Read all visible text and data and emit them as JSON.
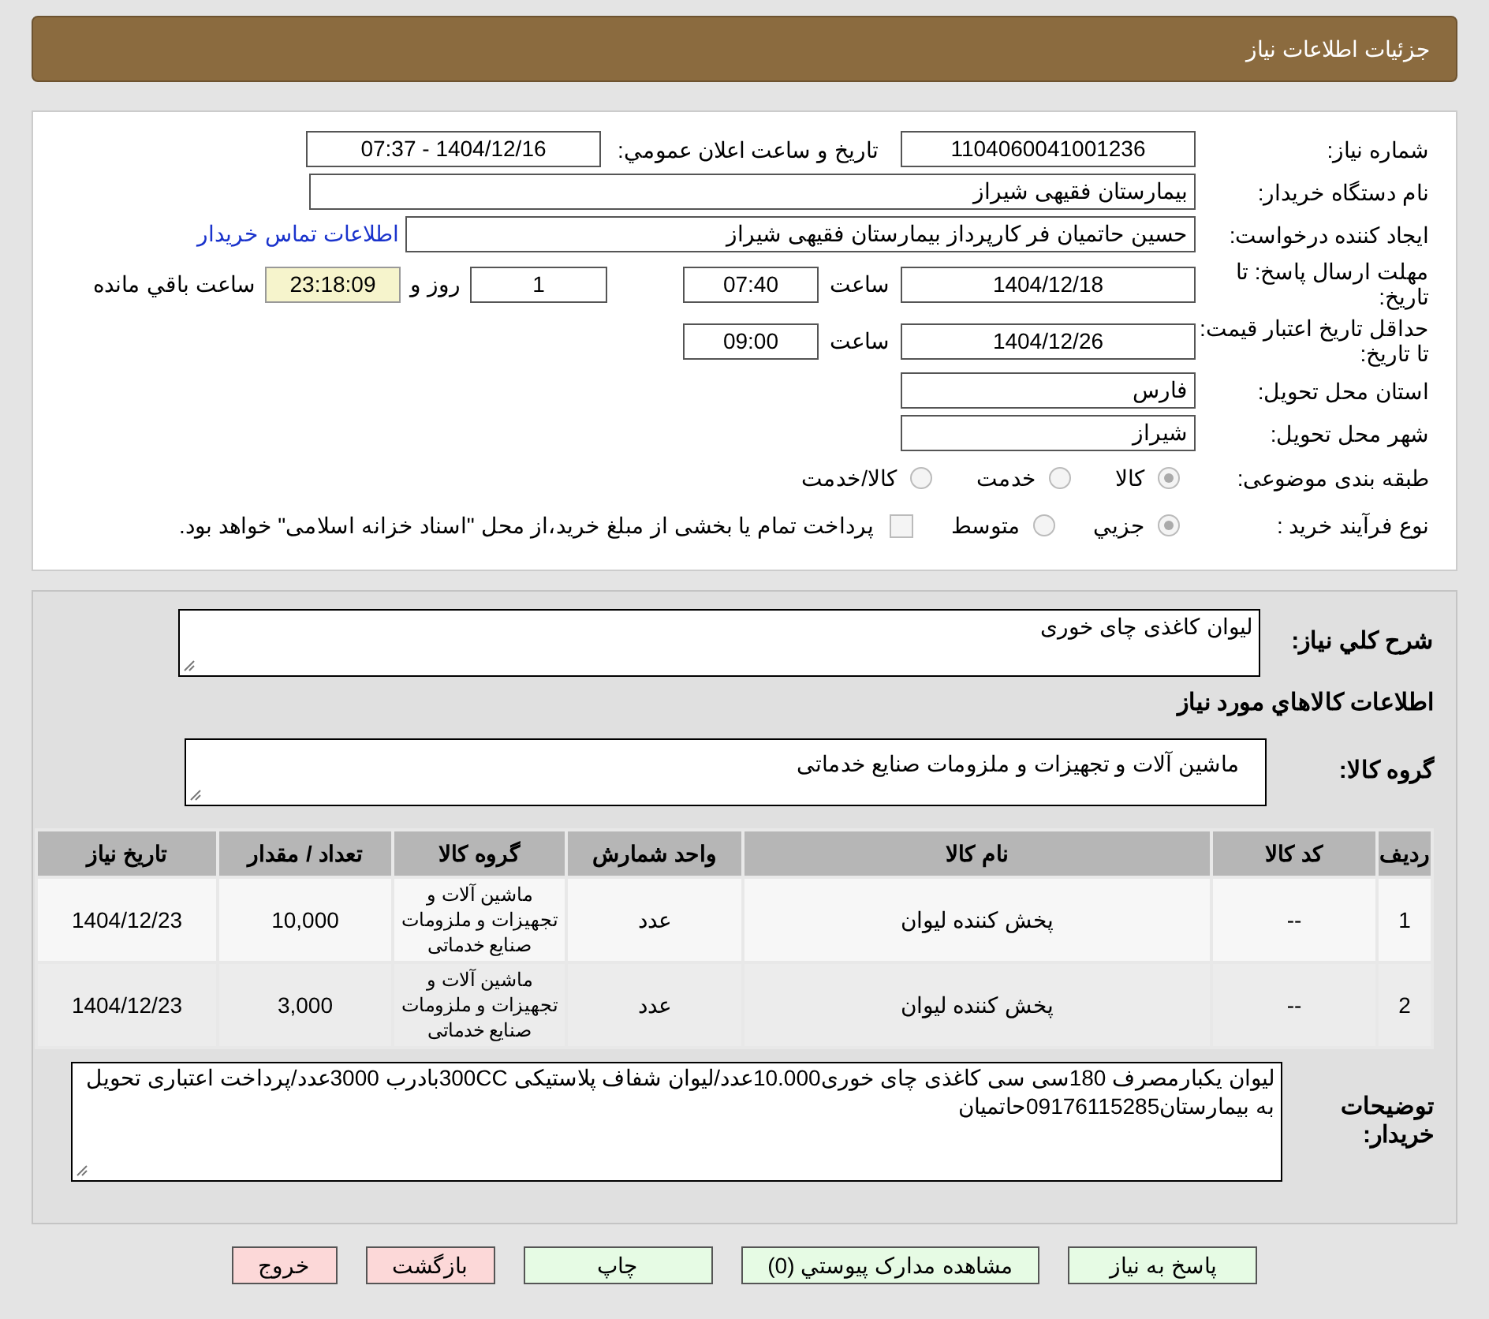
{
  "header": {
    "title": "جزئیات اطلاعات نیاز"
  },
  "general": {
    "need_number": {
      "label": "شماره نیاز:",
      "value": "1104060041001236"
    },
    "announce": {
      "label": "تاریخ و ساعت اعلان عمومي:",
      "value": "1404/12/16 - 07:37"
    },
    "buyer": {
      "label": "نام دستگاه خریدار:",
      "value": "بیمارستان فقیهی شیراز"
    },
    "creator": {
      "label": "ایجاد کننده درخواست:",
      "value": "حسین حاتمیان فر کارپرداز بیمارستان فقیهی شیراز",
      "link": "اطلاعات تماس خریدار"
    },
    "deadline": {
      "label": "مهلت ارسال پاسخ: تا تاریخ:",
      "date": "1404/12/18",
      "time_label": "ساعت",
      "time": "07:40",
      "days": "1",
      "days_label": "روز و",
      "remaining": "23:18:09",
      "remaining_label": "ساعت باقي مانده"
    },
    "validity": {
      "label": "حداقل تاریخ اعتبار قیمت: تا تاریخ:",
      "date": "1404/12/26",
      "time_label": "ساعت",
      "time": "09:00"
    },
    "province": {
      "label": "استان محل تحویل:",
      "value": "فارس"
    },
    "city": {
      "label": "شهر محل تحویل:",
      "value": "شیراز"
    },
    "category": {
      "label": "طبقه بندی موضوعی:",
      "options": [
        {
          "label": "كالا",
          "selected": true
        },
        {
          "label": "خدمت",
          "selected": false
        },
        {
          "label": "كالا/خدمت",
          "selected": false
        }
      ]
    },
    "process": {
      "label": "نوع فرآیند خرید :",
      "options": [
        {
          "label": "جزيي",
          "selected": true
        },
        {
          "label": "متوسط",
          "selected": false
        }
      ],
      "payment": {
        "checked": false,
        "text": "پرداخت تمام یا بخشی از مبلغ خرید،از محل \"اسناد خزانه اسلامی\" خواهد بود."
      }
    }
  },
  "details": {
    "summary": {
      "label": "شرح کلي نیاز:",
      "value": "لیوان کاغذی چای خوری"
    },
    "goods_heading": "اطلاعات کالاهاي مورد نیاز",
    "group": {
      "label": "گروه کالا:",
      "value": "ماشین آلات و تجهیزات و ملزومات صنایع خدماتی"
    },
    "table": {
      "columns": [
        "ردیف",
        "کد کالا",
        "نام کالا",
        "واحد شمارش",
        "گروه کالا",
        "تعداد / مقدار",
        "تاریخ نیاز"
      ],
      "rows": [
        [
          "1",
          "--",
          "پخش کننده لیوان",
          "عدد",
          "ماشین آلات و تجهیزات و ملزومات صنایع خدماتی",
          "10,000",
          "1404/12/23"
        ],
        [
          "2",
          "--",
          "پخش کننده لیوان",
          "عدد",
          "ماشین آلات و تجهیزات و ملزومات صنایع خدماتی",
          "3,000",
          "1404/12/23"
        ]
      ]
    },
    "notes": {
      "label": "توضیحات خریدار:",
      "value": "لیوان یکبارمصرف 180سی سی کاغذی چای خوری10.000عدد/لیوان شفاف پلاستیکی 300CCبادرب 3000عدد/پرداخت اعتباری تحویل به بیمارستان09176115285حاتمیان"
    }
  },
  "buttons": [
    {
      "label": "پاسخ به نیاز",
      "kind": "green"
    },
    {
      "label": "مشاهده مدارک پیوستي (0)",
      "kind": "green"
    },
    {
      "label": "چاپ",
      "kind": "green"
    },
    {
      "label": "بازگشت",
      "kind": "red"
    },
    {
      "label": "خروج",
      "kind": "red"
    }
  ]
}
